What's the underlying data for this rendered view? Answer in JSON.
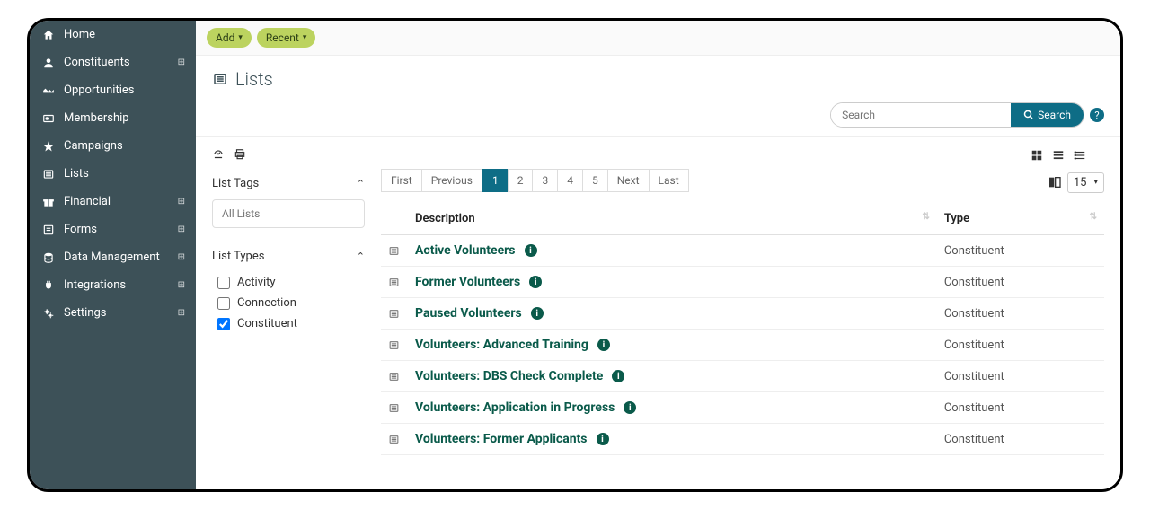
{
  "sidebar": {
    "items": [
      {
        "label": "Home",
        "expandable": false
      },
      {
        "label": "Constituents",
        "expandable": true
      },
      {
        "label": "Opportunities",
        "expandable": false
      },
      {
        "label": "Membership",
        "expandable": false
      },
      {
        "label": "Campaigns",
        "expandable": false
      },
      {
        "label": "Lists",
        "expandable": false
      },
      {
        "label": "Financial",
        "expandable": true
      },
      {
        "label": "Forms",
        "expandable": true
      },
      {
        "label": "Data Management",
        "expandable": true
      },
      {
        "label": "Integrations",
        "expandable": true
      },
      {
        "label": "Settings",
        "expandable": true
      }
    ]
  },
  "topbar": {
    "add": "Add",
    "recent": "Recent"
  },
  "page": {
    "title": "Lists"
  },
  "search": {
    "placeholder": "Search",
    "button": "Search"
  },
  "filters": {
    "list_tags": "List Tags",
    "all_lists_placeholder": "All Lists",
    "list_types": "List Types",
    "types": [
      {
        "label": "Activity",
        "checked": false
      },
      {
        "label": "Connection",
        "checked": false
      },
      {
        "label": "Constituent",
        "checked": true
      }
    ]
  },
  "pagination": {
    "first": "First",
    "previous": "Previous",
    "pages": [
      "1",
      "2",
      "3",
      "4",
      "5"
    ],
    "active": "1",
    "next": "Next",
    "last": "Last",
    "per_page": "15"
  },
  "table": {
    "headers": {
      "description": "Description",
      "type": "Type"
    },
    "rows": [
      {
        "description": "Active Volunteers",
        "type": "Constituent"
      },
      {
        "description": "Former Volunteers",
        "type": "Constituent"
      },
      {
        "description": "Paused Volunteers",
        "type": "Constituent"
      },
      {
        "description": "Volunteers: Advanced Training",
        "type": "Constituent"
      },
      {
        "description": "Volunteers: DBS Check Complete",
        "type": "Constituent"
      },
      {
        "description": "Volunteers: Application in Progress",
        "type": "Constituent"
      },
      {
        "description": "Volunteers: Former Applicants",
        "type": "Constituent"
      }
    ]
  }
}
